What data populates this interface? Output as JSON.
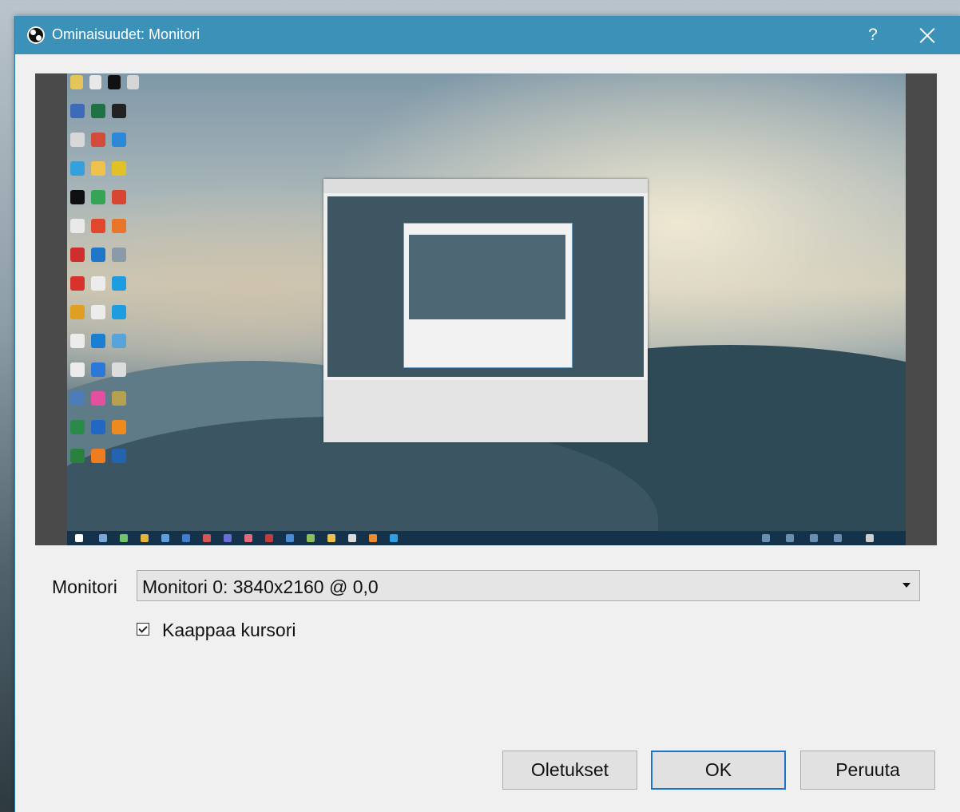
{
  "window": {
    "title": "Ominaisuudet: Monitori",
    "help": "?"
  },
  "form": {
    "monitor_label": "Monitori",
    "monitor_value": "Monitori 0: 3840x2160 @ 0,0",
    "capture_cursor_label": "Kaappaa kursori",
    "capture_cursor_checked": true
  },
  "buttons": {
    "defaults": "Oletukset",
    "ok": "OK",
    "cancel": "Peruuta"
  },
  "colors": {
    "titlebar": "#3c91b9",
    "accent": "#1c74c8",
    "dialog_bg": "#f0f0f0"
  }
}
